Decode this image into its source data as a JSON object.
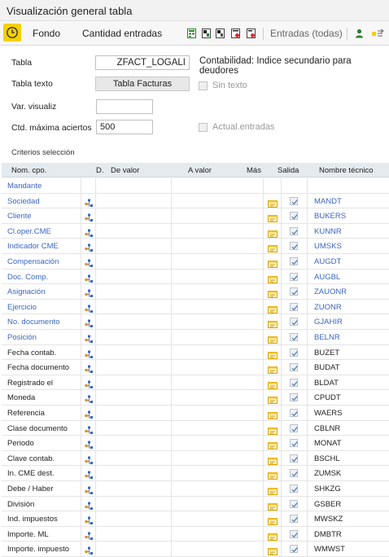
{
  "window": {
    "title": "Visualización general tabla"
  },
  "toolbar": {
    "fondo": "Fondo",
    "cantidad": "Cantidad entradas",
    "entradas": "Entradas (todas)"
  },
  "form": {
    "tabla_label": "Tabla",
    "tabla_value": "ZFACT_LOGALI",
    "tabla_desc": "Contabilidad: Indice secundario para deudores",
    "texto_label": "Tabla texto",
    "texto_value": "Tabla Facturas",
    "sin_texto": "Sin texto",
    "var_label": "Var. visualiz",
    "var_value": "",
    "ctd_label": "Ctd. máxima aciertos",
    "ctd_value": "500",
    "actual": "Actual.entradas"
  },
  "criteria": {
    "section_label": "Criterios selección",
    "headers": {
      "nom": "Nom. cpo.",
      "d": "D.",
      "de": "De valor",
      "a": "A valor",
      "mas": "Más",
      "salida": "Salida",
      "tec": "Nombre técnico"
    },
    "rows": [
      {
        "name": "Mandante",
        "tech": "",
        "key": true,
        "icons": false
      },
      {
        "name": "Sociedad",
        "tech": "MANDT",
        "key": true,
        "icons": true
      },
      {
        "name": "Cliente",
        "tech": "BUKERS",
        "key": true,
        "icons": true
      },
      {
        "name": "Cl.oper.CME",
        "tech": "KUNNR",
        "key": true,
        "icons": true
      },
      {
        "name": "Indicador CME",
        "tech": "UMSKS",
        "key": true,
        "icons": true
      },
      {
        "name": "Compensación",
        "tech": "AUGDT",
        "key": true,
        "icons": true
      },
      {
        "name": "Doc. Comp.",
        "tech": "AUGBL",
        "key": true,
        "icons": true
      },
      {
        "name": "Asignación",
        "tech": "ZAUONR",
        "key": true,
        "icons": true
      },
      {
        "name": "Ejercicio",
        "tech": "ZUONR",
        "key": true,
        "icons": true
      },
      {
        "name": "No. documento",
        "tech": "GJAHIR",
        "key": true,
        "icons": true
      },
      {
        "name": "Posición",
        "tech": "BELNR",
        "key": true,
        "icons": true
      },
      {
        "name": "Fecha contab.",
        "tech": "BUZET",
        "key": false,
        "icons": true
      },
      {
        "name": "Fecha documento",
        "tech": "BUDAT",
        "key": false,
        "icons": true
      },
      {
        "name": "Registrado el",
        "tech": "BLDAT",
        "key": false,
        "icons": true
      },
      {
        "name": "Moneda",
        "tech": "CPUDT",
        "key": false,
        "icons": true
      },
      {
        "name": "Referencia",
        "tech": "WAERS",
        "key": false,
        "icons": true
      },
      {
        "name": "Clase documento",
        "tech": "CBLNR",
        "key": false,
        "icons": true
      },
      {
        "name": "Periodo",
        "tech": "MONAT",
        "key": false,
        "icons": true
      },
      {
        "name": "Clave contab.",
        "tech": "BSCHL",
        "key": false,
        "icons": true
      },
      {
        "name": "In. CME dest.",
        "tech": "ZUMSK",
        "key": false,
        "icons": true
      },
      {
        "name": "Debe / Haber",
        "tech": "SHKZG",
        "key": false,
        "icons": true
      },
      {
        "name": "División",
        "tech": "GSBER",
        "key": false,
        "icons": true
      },
      {
        "name": "Ind. impuestos",
        "tech": "MWSKZ",
        "key": false,
        "icons": true
      },
      {
        "name": "Importe. ML",
        "tech": "DMBTR",
        "key": false,
        "icons": true
      },
      {
        "name": "Importe. impuesto",
        "tech": "WMWST",
        "key": false,
        "icons": true
      }
    ]
  },
  "colors": {
    "accent_yellow": "#f4d000",
    "link_blue": "#3a66c4",
    "header_bg": "#e5eaef"
  }
}
